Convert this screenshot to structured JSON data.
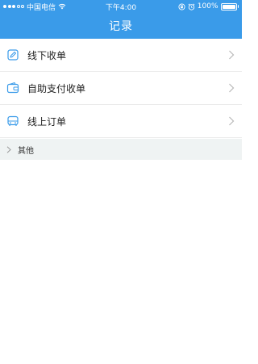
{
  "status_bar": {
    "carrier": "中国电信",
    "time": "下午4:00",
    "battery_text": "100%"
  },
  "nav": {
    "title": "记录"
  },
  "records": {
    "items": [
      {
        "label": "线下收单",
        "icon": "edit-square-icon"
      },
      {
        "label": "自助支付收单",
        "icon": "wallet-icon"
      },
      {
        "label": "线上订单",
        "icon": "bus-icon"
      }
    ]
  },
  "other_section": {
    "label": "其他"
  },
  "colors": {
    "brand_blue": "#3a9be9",
    "divider": "#ebebeb",
    "section_bg": "#eff3f3"
  }
}
